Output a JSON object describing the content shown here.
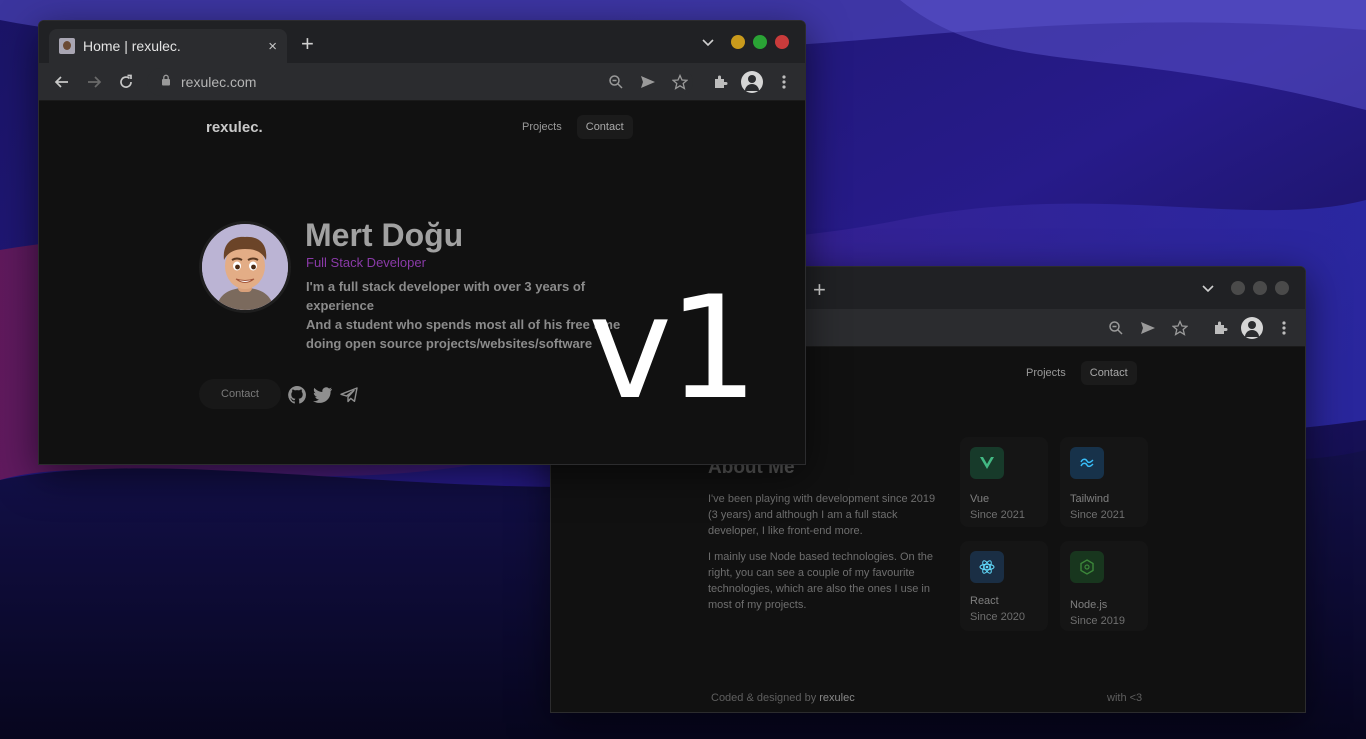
{
  "colors": {
    "vue": "#42b883",
    "tailwind": "#38bdf8",
    "react": "#61dafb",
    "node": "#3c873a",
    "accent_purple": "#8a3aa8",
    "traffic_yellow": "#c99a1c",
    "traffic_green": "#2aa335",
    "traffic_red": "#c93b3b"
  },
  "overlay": {
    "text": "v1"
  },
  "front_window": {
    "tab_title": "Home | rexulec.",
    "tab_close": "×",
    "new_tab": "+",
    "url": "rexulec.com",
    "page": {
      "brand": "rexulec.",
      "nav": [
        "Projects",
        "Contact"
      ],
      "name": "Mert Doğu",
      "role": "Full Stack Developer",
      "bio_line1": "I'm a full stack developer with over 3 years of experience",
      "bio_line2": "And a student who spends most all of his free time doing open source projects/websites/software",
      "contact_button": "Contact",
      "socials": [
        "github-icon",
        "twitter-icon",
        "telegram-icon"
      ]
    }
  },
  "back_window": {
    "new_tab": "+",
    "page": {
      "nav": [
        "Projects",
        "Contact"
      ],
      "about_title": "About Me",
      "about_p1": "I've been playing with development since 2019 (3 years) and although I am a full stack developer, I like front-end more.",
      "about_p2": "I mainly use Node based technologies. On the right, you can see a couple of my favourite technologies, which are also the ones I use in most of my projects.",
      "techs": [
        {
          "name": "Vue",
          "since": "Since 2021"
        },
        {
          "name": "Tailwind",
          "since": "Since 2021"
        },
        {
          "name": "React",
          "since": "Since 2020"
        },
        {
          "name": "Node.js",
          "since": "Since 2019"
        }
      ],
      "footer_prefix": "Coded & designed by",
      "footer_author": "rexulec",
      "footer_right": "with <3"
    }
  }
}
